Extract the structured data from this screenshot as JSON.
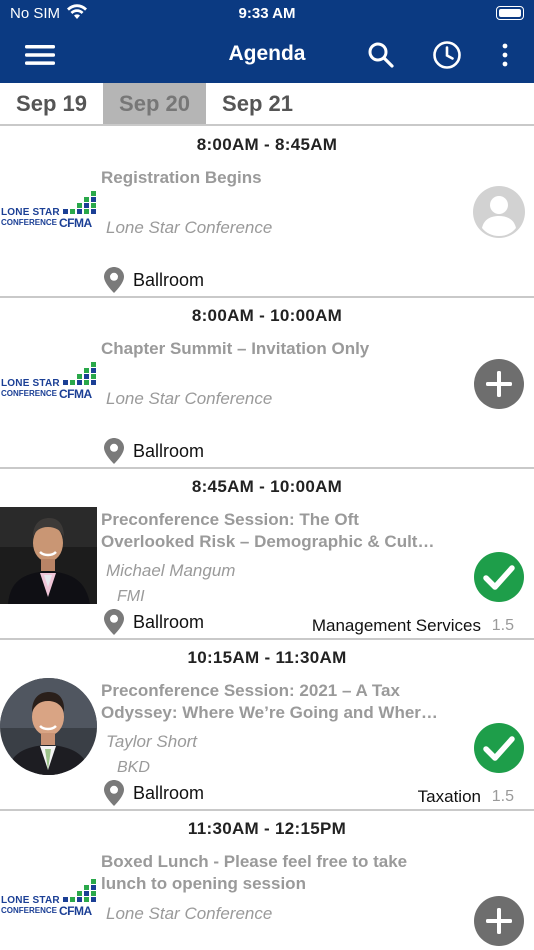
{
  "status_bar": {
    "carrier": "No SIM",
    "time": "9:33 AM"
  },
  "navbar": {
    "title": "Agenda"
  },
  "tabs": [
    {
      "label": "Sep 19",
      "active": false
    },
    {
      "label": "Sep 20",
      "active": true
    },
    {
      "label": "Sep 21",
      "active": false
    }
  ],
  "sessions": [
    {
      "time": "8:00AM - 8:45AM",
      "title_line1": "Registration Begins",
      "title_line2": "",
      "speaker": "Lone Star Conference",
      "org": "",
      "location": "Ballroom",
      "track": "",
      "credits": "",
      "logo": {
        "line1": "LONE STAR",
        "line2": "CONFERENCE",
        "line3": "CFMA"
      },
      "action": "user-placeholder-icon"
    },
    {
      "time": "8:00AM - 10:00AM",
      "title_line1": "Chapter Summit – Invitation Only",
      "title_line2": "",
      "speaker": "Lone Star Conference",
      "org": "",
      "location": "Ballroom",
      "track": "",
      "credits": "",
      "logo": {
        "line1": "LONE STAR",
        "line2": "CONFERENCE",
        "line3": "CFMA"
      },
      "action": "add-icon"
    },
    {
      "time": "8:45AM - 10:00AM",
      "title_line1": "Preconference Session: The Oft",
      "title_line2": "Overlooked Risk – Demographic & Cult…",
      "speaker": "Michael  Mangum",
      "org": "FMI",
      "location": "Ballroom",
      "track": "Management Services",
      "credits": "1.5",
      "action": "check-icon"
    },
    {
      "time": "10:15AM - 11:30AM",
      "title_line1": "Preconference Session: 2021 – A Tax",
      "title_line2": "Odyssey: Where We’re Going and Wher…",
      "speaker": "Taylor Short",
      "org": "BKD",
      "location": "Ballroom",
      "track": "Taxation",
      "credits": "1.5",
      "action": "check-icon"
    },
    {
      "time": "11:30AM - 12:15PM",
      "title_line1": "Boxed Lunch - Please feel free to take",
      "title_line2": "lunch to opening session",
      "speaker": "Lone Star Conference",
      "org": "",
      "location": "",
      "track": "",
      "credits": "",
      "logo": {
        "line1": "LONE STAR",
        "line2": "CONFERENCE",
        "line3": "CFMA"
      },
      "action": "add-icon"
    }
  ],
  "colors": {
    "header": "#0b3a82",
    "check_green": "#1e9e4a",
    "add_gray": "#6e6e6e",
    "title_gray": "#9a9a9a",
    "logo_blue": "#1b3f95",
    "logo_green": "#2aa84a"
  }
}
